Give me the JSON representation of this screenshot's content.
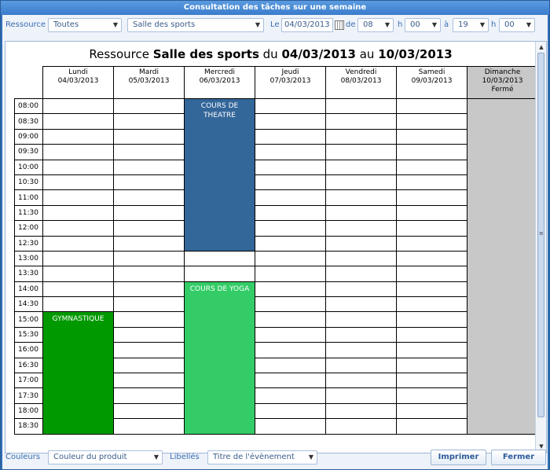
{
  "window": {
    "title": "Consultation des tâches sur une semaine"
  },
  "toolbar": {
    "ressource_label": "Ressource",
    "ressource_type": "Toutes",
    "ressource_name": "Salle des sports",
    "le_label": "Le",
    "date": "04/03/2013",
    "de_label": "de",
    "start_hour": "08",
    "h1_label": "h",
    "start_min": "00",
    "a_label": "à",
    "end_hour": "19",
    "h2_label": "h",
    "end_min": "00"
  },
  "heading": {
    "prefix": "Ressource",
    "resource": "Salle des sports",
    "du": "du",
    "start": "04/03/2013",
    "au": "au",
    "end": "10/03/2013"
  },
  "days": [
    {
      "name": "Lundi",
      "date": "04/03/2013",
      "note": ""
    },
    {
      "name": "Mardi",
      "date": "05/03/2013",
      "note": ""
    },
    {
      "name": "Mercredi",
      "date": "06/03/2013",
      "note": ""
    },
    {
      "name": "Jeudi",
      "date": "07/03/2013",
      "note": ""
    },
    {
      "name": "Vendredi",
      "date": "08/03/2013",
      "note": ""
    },
    {
      "name": "Samedi",
      "date": "09/03/2013",
      "note": ""
    },
    {
      "name": "Dimanche",
      "date": "10/03/2013",
      "note": "Fermé"
    }
  ],
  "times": [
    "08:00",
    "08:30",
    "09:00",
    "09:30",
    "10:00",
    "10:30",
    "11:00",
    "11:30",
    "12:00",
    "12:30",
    "13:00",
    "13:30",
    "14:00",
    "14:30",
    "15:00",
    "15:30",
    "16:00",
    "16:30",
    "17:00",
    "17:30",
    "18:00",
    "18:30"
  ],
  "events": [
    {
      "label": "COURS DE THEATRE",
      "day": 2,
      "start": "08:00",
      "end": "13:00",
      "color": "#336699"
    },
    {
      "label": "COURS DE YOGA",
      "day": 2,
      "start": "14:00",
      "end": "19:00",
      "color": "#33cc66"
    },
    {
      "label": "GYMNASTIQUE",
      "day": 0,
      "start": "15:00",
      "end": "19:00",
      "color": "#009900"
    }
  ],
  "closed_day": 6,
  "closed_color": "#c8c8c8",
  "bottom": {
    "couleurs_label": "Couleurs",
    "couleurs_value": "Couleur du produit",
    "libelles_label": "Libellés",
    "libelles_value": "Titre de l'évènement",
    "print_label": "Imprimer",
    "close_label": "Fermer"
  }
}
